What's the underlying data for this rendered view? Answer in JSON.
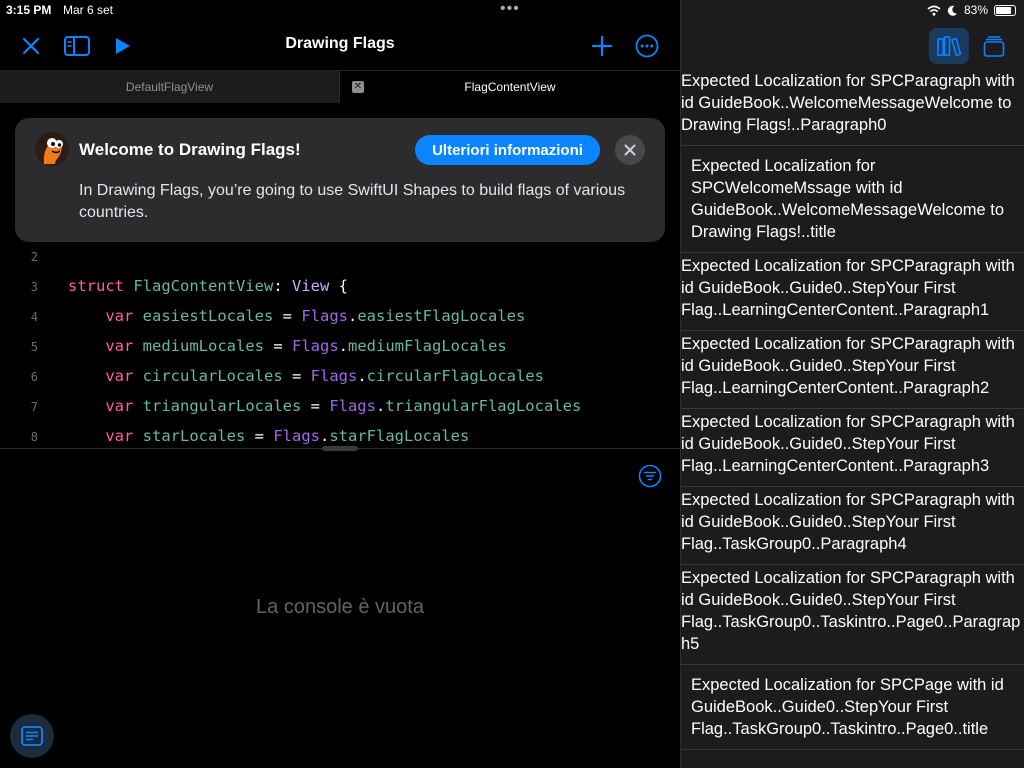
{
  "status": {
    "time": "3:15 PM",
    "date": "Mar 6 set",
    "battery": "83%",
    "battery_level": 0.83
  },
  "toolbar": {
    "title": "Drawing Flags"
  },
  "tabs": [
    {
      "label": "DefaultFlagView",
      "active": false
    },
    {
      "label": "FlagContentView",
      "active": true
    }
  ],
  "banner": {
    "title": "Welcome to Drawing Flags!",
    "button_label": "Ulteriori informazioni",
    "text": "In Drawing Flags, you’re going to use SwiftUI Shapes to build flags of various countries."
  },
  "code": {
    "lines": [
      {
        "number": "2",
        "tokens": []
      },
      {
        "number": "3",
        "tokens": [
          {
            "t": "struct ",
            "c": "kw"
          },
          {
            "t": "FlagContentView",
            "c": "id"
          },
          {
            "t": ": ",
            "c": ""
          },
          {
            "t": "View",
            "c": "ty"
          },
          {
            "t": " {",
            "c": ""
          }
        ]
      },
      {
        "number": "4",
        "tokens": [
          {
            "t": "    ",
            "c": ""
          },
          {
            "t": "var",
            "c": "kw"
          },
          {
            "t": " ",
            "c": ""
          },
          {
            "t": "easiestLocales",
            "c": "id"
          },
          {
            "t": " = ",
            "c": ""
          },
          {
            "t": "Flags",
            "c": "typ2"
          },
          {
            "t": ".",
            "c": ""
          },
          {
            "t": "easiestFlagLocales",
            "c": "id"
          }
        ]
      },
      {
        "number": "5",
        "tokens": [
          {
            "t": "    ",
            "c": ""
          },
          {
            "t": "var",
            "c": "kw"
          },
          {
            "t": " ",
            "c": ""
          },
          {
            "t": "mediumLocales",
            "c": "id"
          },
          {
            "t": " = ",
            "c": ""
          },
          {
            "t": "Flags",
            "c": "typ2"
          },
          {
            "t": ".",
            "c": ""
          },
          {
            "t": "mediumFlagLocales",
            "c": "id"
          }
        ]
      },
      {
        "number": "6",
        "tokens": [
          {
            "t": "    ",
            "c": ""
          },
          {
            "t": "var",
            "c": "kw"
          },
          {
            "t": " ",
            "c": ""
          },
          {
            "t": "circularLocales",
            "c": "id"
          },
          {
            "t": " = ",
            "c": ""
          },
          {
            "t": "Flags",
            "c": "typ2"
          },
          {
            "t": ".",
            "c": ""
          },
          {
            "t": "circularFlagLocales",
            "c": "id"
          }
        ]
      },
      {
        "number": "7",
        "tokens": [
          {
            "t": "    ",
            "c": ""
          },
          {
            "t": "var",
            "c": "kw"
          },
          {
            "t": " ",
            "c": ""
          },
          {
            "t": "triangularLocales",
            "c": "id"
          },
          {
            "t": " = ",
            "c": ""
          },
          {
            "t": "Flags",
            "c": "typ2"
          },
          {
            "t": ".",
            "c": ""
          },
          {
            "t": "triangularFlagLocales",
            "c": "id"
          }
        ]
      },
      {
        "number": "8",
        "tokens": [
          {
            "t": "    ",
            "c": ""
          },
          {
            "t": "var",
            "c": "kw"
          },
          {
            "t": " ",
            "c": ""
          },
          {
            "t": "starLocales",
            "c": "id"
          },
          {
            "t": " = ",
            "c": ""
          },
          {
            "t": "Flags",
            "c": "typ2"
          },
          {
            "t": ".",
            "c": ""
          },
          {
            "t": "starFlagLocales",
            "c": "id"
          }
        ]
      }
    ]
  },
  "console": {
    "empty_text": "La console è vuota"
  },
  "colors": {
    "accent": "#0a84ff",
    "keyword": "#fc5fa3",
    "identifier": "#67b7a4",
    "type": "#d0a8ff"
  },
  "localizations": [
    {
      "text": "Expected Localization for SPCParagraph with id GuideBook..WelcomeMessageWelcome to Drawing Flags!..Paragraph0",
      "indent": false
    },
    {
      "text": "Expected Localization for SPCWelcomeMssage with id GuideBook..WelcomeMessageWelcome to Drawing Flags!..title",
      "indent": true
    },
    {
      "text": "Expected Localization for SPCParagraph with id GuideBook..Guide0..StepYour First Flag..LearningCenterContent..Paragraph1",
      "indent": false
    },
    {
      "text": "Expected Localization for SPCParagraph with id GuideBook..Guide0..StepYour First Flag..LearningCenterContent..Paragraph2",
      "indent": false
    },
    {
      "text": "Expected Localization for SPCParagraph with id GuideBook..Guide0..StepYour First Flag..LearningCenterContent..Paragraph3",
      "indent": false
    },
    {
      "text": "Expected Localization for SPCParagraph with id GuideBook..Guide0..StepYour First Flag..TaskGroup0..Paragraph4",
      "indent": false
    },
    {
      "text": "Expected Localization for SPCParagraph with id GuideBook..Guide0..StepYour First Flag..TaskGroup0..Taskintro..Page0..Paragraph5",
      "indent": false
    },
    {
      "text": "Expected Localization for SPCPage with id GuideBook..Guide0..StepYour First Flag..TaskGroup0..Taskintro..Page0..title",
      "indent": true
    }
  ]
}
